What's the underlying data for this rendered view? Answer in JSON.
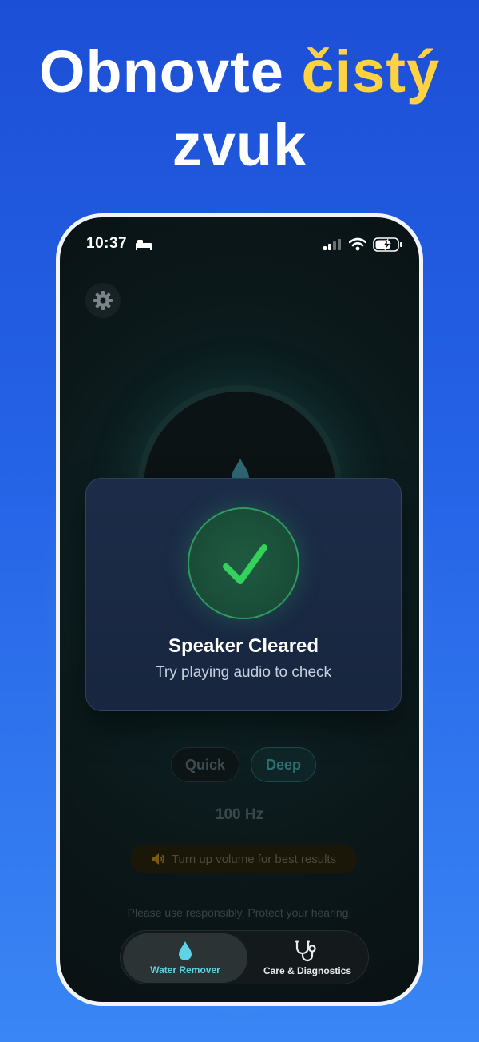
{
  "headline": {
    "part1": "Obnovte",
    "highlight": "čistý",
    "part2": "zvuk"
  },
  "status_bar": {
    "time": "10:37"
  },
  "modal": {
    "title": "Speaker Cleared",
    "subtitle": "Try playing audio to check"
  },
  "modes": [
    {
      "label": "Quick",
      "selected": false
    },
    {
      "label": "Deep",
      "selected": true
    }
  ],
  "frequency": "100 Hz",
  "volume_hint": "Turn up volume for best results",
  "responsible_note": "Please use responsibly. Protect your hearing.",
  "tabs": [
    {
      "label": "Water Remover",
      "icon": "water-drop-icon",
      "active": true
    },
    {
      "label": "Care & Diagnostics",
      "icon": "stethoscope-icon",
      "active": false
    }
  ],
  "colors": {
    "background": "#2563e6",
    "highlight": "#ffd23f",
    "success": "#2fd15a",
    "accent": "#5fd3e6"
  }
}
